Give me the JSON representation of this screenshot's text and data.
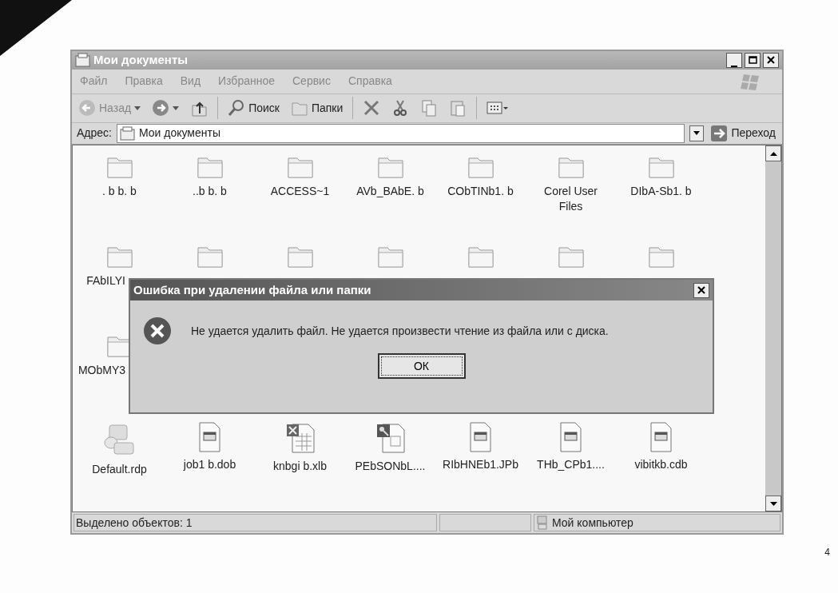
{
  "window": {
    "title": "Мои документы"
  },
  "menu": [
    "Файл",
    "Правка",
    "Вид",
    "Избранное",
    "Сервис",
    "Справка"
  ],
  "toolbar": [
    {
      "kind": "back",
      "label": "Назад"
    },
    {
      "kind": "forward"
    },
    {
      "kind": "up"
    },
    {
      "kind": "search",
      "label": "Поиск"
    },
    {
      "kind": "folders",
      "label": "Папки"
    },
    {
      "kind": "delete"
    },
    {
      "kind": "cut"
    },
    {
      "kind": "copy"
    },
    {
      "kind": "paste"
    },
    {
      "kind": "views"
    }
  ],
  "address": {
    "label": "Адрес:",
    "value": "Мои документы",
    "go": "Переход"
  },
  "rows": [
    [
      {
        "kind": "folder",
        "name": ". b  b.  b"
      },
      {
        "kind": "folder",
        "name": "..b  b.  b"
      },
      {
        "kind": "folder",
        "name": "ACCESS~1"
      },
      {
        "kind": "folder",
        "name": "AVb_BAbE.  b"
      },
      {
        "kind": "folder",
        "name": "CObTINb1.  b"
      },
      {
        "kind": "folder",
        "name": "Corel User Files"
      },
      {
        "kind": "folder",
        "name": "DIbA-Sb1.  b"
      }
    ],
    [
      {
        "kind": "folder",
        "name": "FAbILYI"
      },
      {
        "kind": "folder"
      },
      {
        "kind": "folder"
      },
      {
        "kind": "folder"
      },
      {
        "kind": "folder"
      },
      {
        "kind": "folder"
      },
      {
        "kind": "folder"
      }
    ],
    [
      {
        "kind": "folder",
        "name": "MObMY3"
      }
    ],
    [
      {
        "kind": "remote",
        "name": "Default.rdp"
      },
      {
        "kind": "document",
        "name": "job1  b.dob"
      },
      {
        "kind": "spreadsheet",
        "name": "knbgi b.xlb"
      },
      {
        "kind": "database",
        "name": "PEbSONbL...."
      },
      {
        "kind": "document",
        "name": "RIbHNEb1.JPb"
      },
      {
        "kind": "document",
        "name": "THb_CPb1...."
      },
      {
        "kind": "document",
        "name": "vibitkb.cdb"
      }
    ]
  ],
  "dialog": {
    "title": "Ошибка при удалении файла или папки",
    "message": "Не удается удалить файл. Не удается произвести чтение из файла или с диска.",
    "button": "ОК"
  },
  "status": {
    "selection": "Выделено объектов: 1",
    "location": "Мой компьютер"
  },
  "page_number": "4"
}
